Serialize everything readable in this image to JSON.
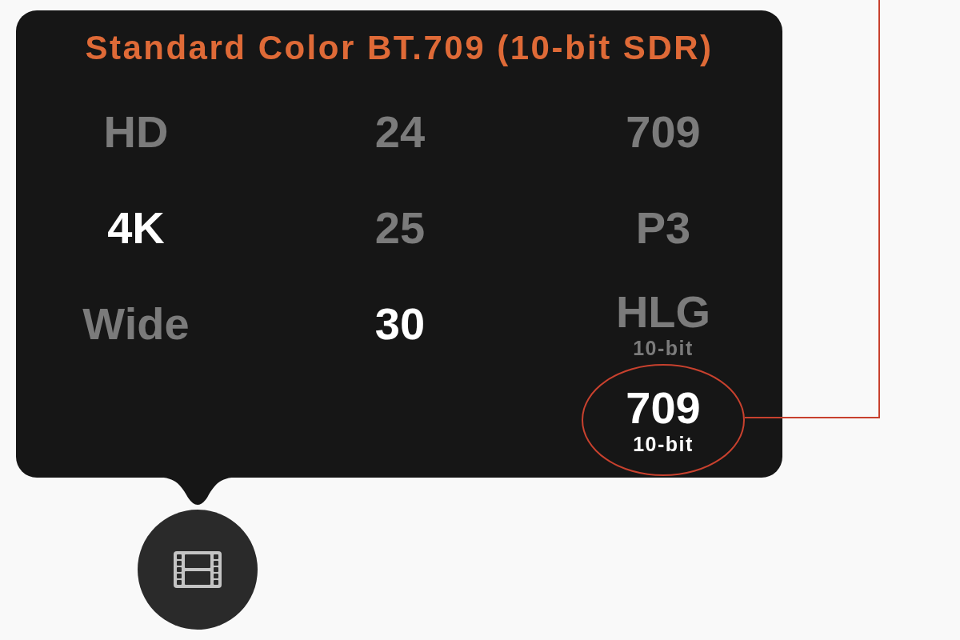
{
  "popover": {
    "title": "Standard Color BT.709 (10-bit SDR)",
    "columns": [
      {
        "options": [
          {
            "label": "HD",
            "selected": false,
            "circled": false
          },
          {
            "label": "4K",
            "selected": true,
            "circled": false
          },
          {
            "label": "Wide",
            "selected": false,
            "circled": false
          }
        ]
      },
      {
        "options": [
          {
            "label": "24",
            "selected": false,
            "circled": false
          },
          {
            "label": "25",
            "selected": false,
            "circled": false
          },
          {
            "label": "30",
            "selected": true,
            "circled": false
          }
        ]
      },
      {
        "options": [
          {
            "label": "709",
            "selected": false,
            "circled": false
          },
          {
            "label": "P3",
            "selected": false,
            "circled": false
          },
          {
            "label": "HLG",
            "sublabel": "10-bit",
            "selected": false,
            "circled": false
          },
          {
            "label": "709",
            "sublabel": "10-bit",
            "selected": true,
            "circled": true
          }
        ]
      }
    ]
  }
}
